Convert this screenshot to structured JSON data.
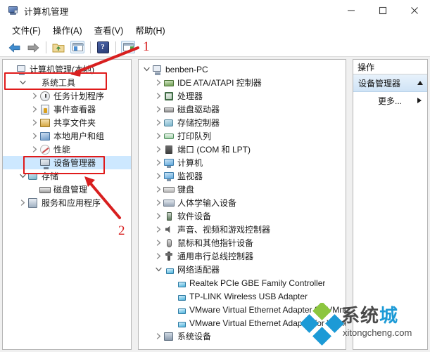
{
  "window": {
    "title": "计算机管理",
    "icon": "computer-management-icon",
    "minimize_label": "—",
    "maximize_label": "□",
    "close_label": "✕"
  },
  "menubar": {
    "items": [
      {
        "label": "文件(F)",
        "name": "menu-file"
      },
      {
        "label": "操作(A)",
        "name": "menu-action"
      },
      {
        "label": "查看(V)",
        "name": "menu-view"
      },
      {
        "label": "帮助(H)",
        "name": "menu-help"
      }
    ]
  },
  "toolbar": {
    "items": [
      {
        "icon": "back-arrow-icon",
        "label": ""
      },
      {
        "icon": "forward-arrow-icon",
        "label": ""
      },
      {
        "icon": "up-folder-icon",
        "label": ""
      },
      {
        "icon": "show-console-tree-icon",
        "label": ""
      },
      {
        "icon": "help-icon",
        "label": "?"
      },
      {
        "icon": "show-action-pane-icon",
        "label": ""
      }
    ]
  },
  "left_tree": {
    "items": [
      {
        "label": "计算机管理(本地)",
        "icon": "computer-management-icon",
        "indent": 0,
        "expander": "none",
        "selected": false
      },
      {
        "label": "系统工具",
        "icon": "system-tools-icon",
        "indent": 1,
        "expander": "expanded",
        "selected": false
      },
      {
        "label": "任务计划程序",
        "icon": "task-scheduler-icon",
        "indent": 2,
        "expander": "collapsed",
        "selected": false
      },
      {
        "label": "事件查看器",
        "icon": "event-viewer-icon",
        "indent": 2,
        "expander": "collapsed",
        "selected": false
      },
      {
        "label": "共享文件夹",
        "icon": "shared-folders-icon",
        "indent": 2,
        "expander": "collapsed",
        "selected": false
      },
      {
        "label": "本地用户和组",
        "icon": "local-users-groups-icon",
        "indent": 2,
        "expander": "collapsed",
        "selected": false
      },
      {
        "label": "性能",
        "icon": "performance-icon",
        "indent": 2,
        "expander": "collapsed",
        "selected": false
      },
      {
        "label": "设备管理器",
        "icon": "device-manager-icon",
        "indent": 2,
        "expander": "none",
        "selected": true
      },
      {
        "label": "存储",
        "icon": "storage-icon",
        "indent": 1,
        "expander": "expanded",
        "selected": false
      },
      {
        "label": "磁盘管理",
        "icon": "disk-management-icon",
        "indent": 2,
        "expander": "none",
        "selected": false
      },
      {
        "label": "服务和应用程序",
        "icon": "services-applications-icon",
        "indent": 1,
        "expander": "collapsed",
        "selected": false
      }
    ]
  },
  "device_tree": {
    "items": [
      {
        "label": "benben-PC",
        "icon": "computer-icon",
        "indent": 0,
        "expander": "expanded"
      },
      {
        "label": "IDE ATA/ATAPI 控制器",
        "icon": "ide-controller-icon",
        "indent": 1,
        "expander": "collapsed"
      },
      {
        "label": "处理器",
        "icon": "processor-icon",
        "indent": 1,
        "expander": "collapsed"
      },
      {
        "label": "磁盘驱动器",
        "icon": "disk-drive-icon",
        "indent": 1,
        "expander": "collapsed"
      },
      {
        "label": "存储控制器",
        "icon": "storage-controller-icon",
        "indent": 1,
        "expander": "collapsed"
      },
      {
        "label": "打印队列",
        "icon": "print-queue-icon",
        "indent": 1,
        "expander": "collapsed"
      },
      {
        "label": "端口 (COM 和 LPT)",
        "icon": "port-icon",
        "indent": 1,
        "expander": "collapsed"
      },
      {
        "label": "计算机",
        "icon": "computer-monitor-icon",
        "indent": 1,
        "expander": "collapsed"
      },
      {
        "label": "监视器",
        "icon": "monitor-icon",
        "indent": 1,
        "expander": "collapsed"
      },
      {
        "label": "键盘",
        "icon": "keyboard-icon",
        "indent": 1,
        "expander": "collapsed"
      },
      {
        "label": "人体学输入设备",
        "icon": "hid-icon",
        "indent": 1,
        "expander": "collapsed"
      },
      {
        "label": "软件设备",
        "icon": "software-device-icon",
        "indent": 1,
        "expander": "collapsed"
      },
      {
        "label": "声音、视频和游戏控制器",
        "icon": "sound-video-game-icon",
        "indent": 1,
        "expander": "collapsed"
      },
      {
        "label": "鼠标和其他指针设备",
        "icon": "mouse-icon",
        "indent": 1,
        "expander": "collapsed"
      },
      {
        "label": "通用串行总线控制器",
        "icon": "usb-controller-icon",
        "indent": 1,
        "expander": "collapsed"
      },
      {
        "label": "网络适配器",
        "icon": "network-adapter-icon",
        "indent": 1,
        "expander": "expanded"
      },
      {
        "label": "Realtek PCIe GBE Family Controller",
        "icon": "network-device-icon",
        "indent": 2,
        "expander": "none"
      },
      {
        "label": "TP-LINK Wireless USB Adapter",
        "icon": "network-device-icon",
        "indent": 2,
        "expander": "none"
      },
      {
        "label": "VMware Virtual Ethernet Adapter for VMnet1",
        "icon": "network-device-icon",
        "indent": 2,
        "expander": "none"
      },
      {
        "label": "VMware Virtual Ethernet Adapter for VMnet8",
        "icon": "network-device-icon",
        "indent": 2,
        "expander": "none"
      },
      {
        "label": "系统设备",
        "icon": "system-device-icon",
        "indent": 1,
        "expander": "collapsed"
      }
    ]
  },
  "actions_panel": {
    "header": "操作",
    "section_title": "设备管理器",
    "section_collapse_icon": "triangle-up-icon",
    "more_label": "更多...",
    "more_arrow_icon": "triangle-right-icon"
  },
  "annotations": [
    {
      "number": "1",
      "name": "annotation-1",
      "target": "系统工具"
    },
    {
      "number": "2",
      "name": "annotation-2",
      "target": "设备管理器"
    }
  ],
  "watermark": {
    "text_main": "系统",
    "text_accent": "城",
    "url": "xitongcheng.com"
  },
  "colors": {
    "accent_red": "#e01b1b",
    "selection_blue": "#cde8ff",
    "watermark_blue": "#1c9ad6",
    "watermark_green": "#8cc63f"
  }
}
